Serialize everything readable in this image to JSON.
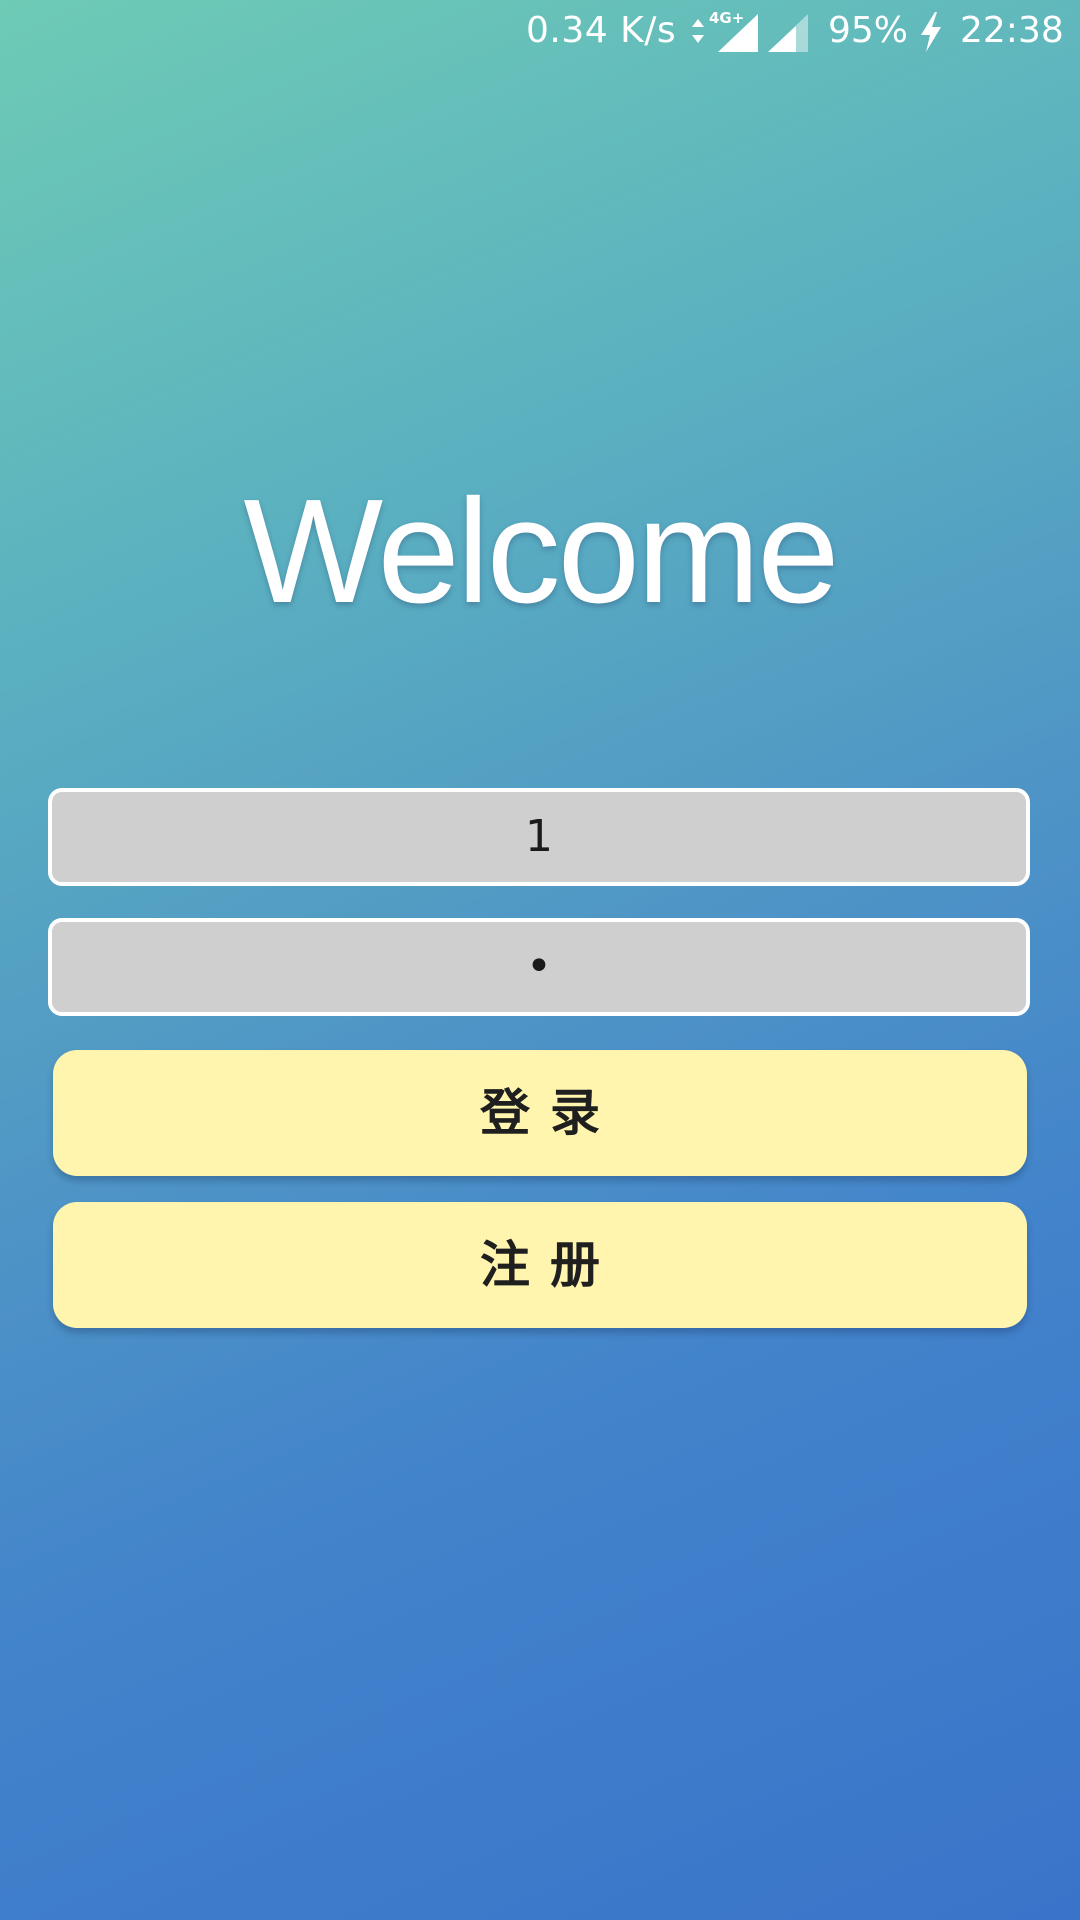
{
  "status_bar": {
    "net_speed": "0.34 K/s",
    "network_type": "4G+",
    "battery": "95%",
    "time": "22:38",
    "icons": [
      "data-arrows-icon",
      "signal-icon",
      "signal-icon",
      "charging-icon"
    ]
  },
  "welcome": {
    "title": "Welcome"
  },
  "form": {
    "username_value": "1",
    "password_value": "•",
    "login_label": "登录",
    "register_label": "注册"
  },
  "colors": {
    "gradient_start": "#6ecbb5",
    "gradient_end": "#3a74ca",
    "input_background": "#cfcfcf",
    "button_background": "#fff5ae",
    "text_white": "#ffffff"
  }
}
